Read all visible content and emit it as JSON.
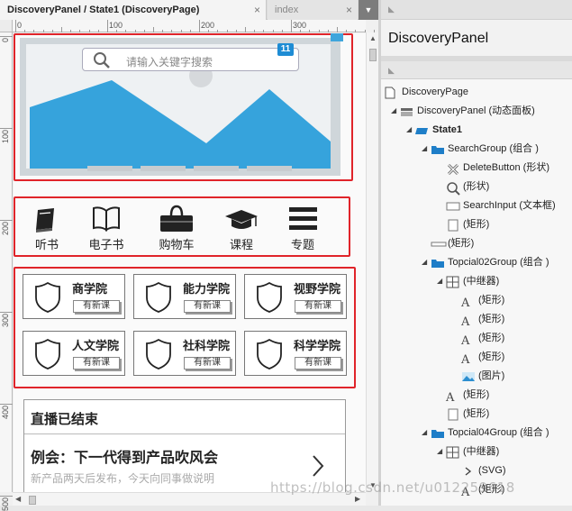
{
  "tabs": [
    {
      "label": "DiscoveryPanel / State1 (DiscoveryPage)",
      "close": "×",
      "active": true
    },
    {
      "label": "index",
      "close": "×",
      "active": false
    }
  ],
  "tab_dropdown": "▼",
  "ruler": {
    "h": [
      "0",
      "100",
      "200",
      "300"
    ],
    "v": [
      "0",
      "100",
      "200",
      "300",
      "400",
      "500"
    ]
  },
  "banner": {
    "search_placeholder": "请输入关键字搜索",
    "badge": "11"
  },
  "nav": [
    {
      "label": "听书",
      "icon": "book-icon"
    },
    {
      "label": "电子书",
      "icon": "open-book-icon"
    },
    {
      "label": "购物车",
      "icon": "shopping-bag-icon"
    },
    {
      "label": "课程",
      "icon": "graduation-cap-icon"
    },
    {
      "label": "专题",
      "icon": "menu-icon"
    }
  ],
  "academies": [
    {
      "name": "商学院",
      "button": "有新课"
    },
    {
      "name": "能力学院",
      "button": "有新课"
    },
    {
      "name": "视野学院",
      "button": "有新课"
    },
    {
      "name": "人文学院",
      "button": "有新课"
    },
    {
      "name": "社科学院",
      "button": "有新课"
    },
    {
      "name": "科学学院",
      "button": "有新课"
    }
  ],
  "live": {
    "title": "直播已结束",
    "headline": "例会：下一代得到产品吹风会",
    "subtitle": "新产品两天后发布，今天向同事做说明"
  },
  "watermark": "https://blog.csdn.net/u012259618",
  "inspector": {
    "title": "DiscoveryPanel"
  },
  "outline": [
    {
      "label": "DiscoveryPage",
      "icon": "page-icon",
      "indent": 0,
      "twisty": "",
      "bold": false
    },
    {
      "label": "DiscoveryPanel (动态面板)",
      "icon": "dynamic-panel-icon",
      "indent": 1,
      "twisty": "◢",
      "bold": false
    },
    {
      "label": "State1",
      "icon": "state-icon",
      "indent": 2,
      "twisty": "◢",
      "bold": true
    },
    {
      "label": "SearchGroup (组合 )",
      "icon": "folder-icon",
      "indent": 3,
      "twisty": "◢",
      "bold": false
    },
    {
      "label": "DeleteButton (形状)",
      "icon": "delete-shape-icon",
      "indent": 4,
      "twisty": "",
      "bold": false
    },
    {
      "label": "(形状)",
      "icon": "magnifier-shape-icon",
      "indent": 4,
      "twisty": "",
      "bold": false
    },
    {
      "label": "SearchInput (文本框)",
      "icon": "textbox-icon",
      "indent": 4,
      "twisty": "",
      "bold": false
    },
    {
      "label": "(矩形)",
      "icon": "rectangle-icon",
      "indent": 4,
      "twisty": "",
      "bold": false
    },
    {
      "label": "(矩形)",
      "icon": "line-rectangle-icon",
      "indent": 3,
      "twisty": "",
      "bold": false
    },
    {
      "label": "Topcial02Group (组合 )",
      "icon": "folder-icon",
      "indent": 3,
      "twisty": "◢",
      "bold": false
    },
    {
      "label": "(中继器)",
      "icon": "repeater-icon",
      "indent": 4,
      "twisty": "◢",
      "bold": false
    },
    {
      "label": "(矩形)",
      "icon": "text-icon",
      "indent": 5,
      "twisty": "",
      "bold": false
    },
    {
      "label": "(矩形)",
      "icon": "text-icon",
      "indent": 5,
      "twisty": "",
      "bold": false
    },
    {
      "label": "(矩形)",
      "icon": "text-icon",
      "indent": 5,
      "twisty": "",
      "bold": false
    },
    {
      "label": "(矩形)",
      "icon": "text-icon",
      "indent": 5,
      "twisty": "",
      "bold": false
    },
    {
      "label": "(图片)",
      "icon": "image-icon",
      "indent": 5,
      "twisty": "",
      "bold": false
    },
    {
      "label": "(矩形)",
      "icon": "text-icon",
      "indent": 4,
      "twisty": "",
      "bold": false
    },
    {
      "label": "(矩形)",
      "icon": "rectangle-icon",
      "indent": 4,
      "twisty": "",
      "bold": false
    },
    {
      "label": "Topcial04Group (组合 )",
      "icon": "folder-icon",
      "indent": 3,
      "twisty": "◢",
      "bold": false
    },
    {
      "label": "(中继器)",
      "icon": "repeater-icon",
      "indent": 4,
      "twisty": "◢",
      "bold": false
    },
    {
      "label": "(SVG)",
      "icon": "svg-chevron-icon",
      "indent": 5,
      "twisty": "",
      "bold": false
    },
    {
      "label": "(矩形)",
      "icon": "text-icon",
      "indent": 5,
      "twisty": "",
      "bold": false
    }
  ]
}
